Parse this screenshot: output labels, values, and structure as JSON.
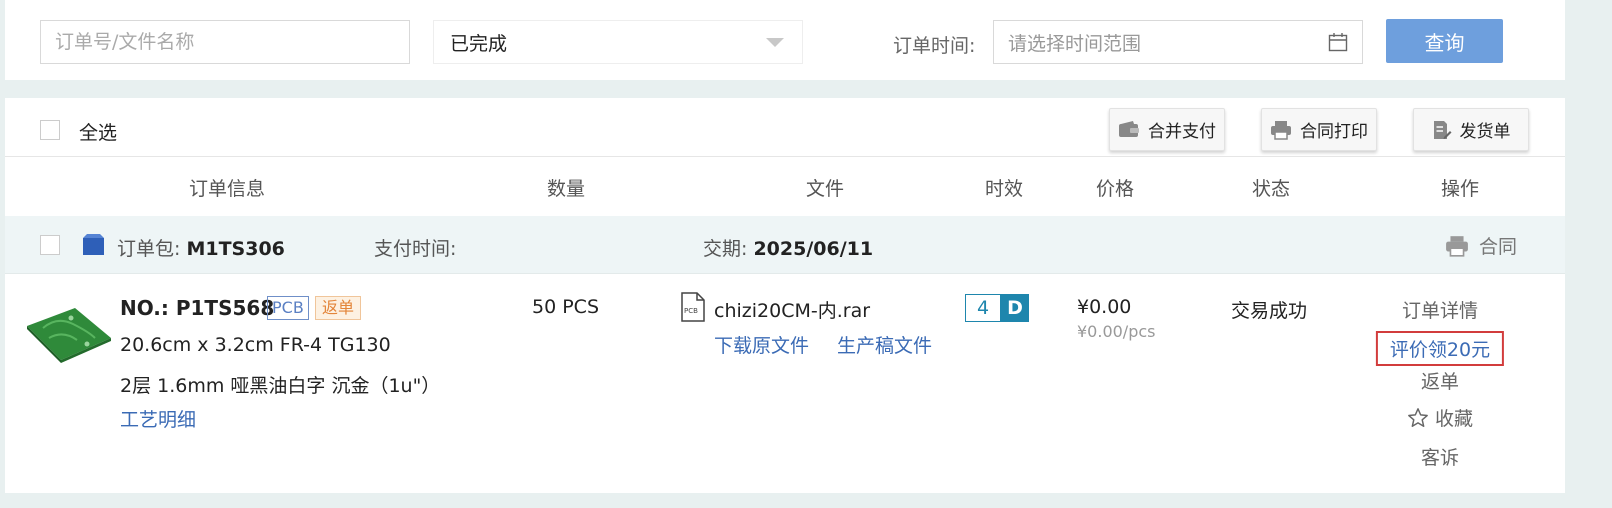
{
  "filters": {
    "search_placeholder": "订单号/文件名称",
    "status_value": "已完成",
    "time_label": "订单时间:",
    "time_placeholder": "请选择时间范围",
    "query_label": "查询"
  },
  "toolbar": {
    "select_all": "全选",
    "merge_pay": "合并支付",
    "merge_print": "合同打印",
    "shipping": "发货单"
  },
  "columns": [
    "订单信息",
    "数量",
    "文件",
    "时效",
    "价格",
    "状态",
    "操作"
  ],
  "package": {
    "label": "订单包:",
    "id": "M1TS306",
    "pay_time_label": "支付时间:",
    "delivery_label": "交期:",
    "delivery_date": "2025/06/11",
    "contract": "合同"
  },
  "order": {
    "number": "NO.: P1TS568",
    "type_tag": "PCB",
    "return_tag": "返单",
    "spec1": "20.6cm x 3.2cm FR-4 TG130",
    "spec2": "2层 1.6mm 哑黑油白字 沉金（1u\"）",
    "craft_link": "工艺明细",
    "quantity": "50 PCS",
    "file_icon_label": "PCB",
    "file_name": "chizi20CM-内.rar",
    "download_link": "下载原文件",
    "production_link": "生产稿文件",
    "lead_time": "4",
    "lead_unit": "D",
    "price": "¥0.00",
    "unit_price": "¥0.00/pcs",
    "status": "交易成功",
    "ops": {
      "detail": "订单详情",
      "review": "评价领20元",
      "reorder": "返单",
      "favorite": "收藏",
      "complain": "客诉"
    }
  },
  "colors": {
    "accent": "#3b6bb5",
    "query_button": "#6e9fdd",
    "lead_time": "#1e86ad",
    "highlight_border": "#d23c3c"
  }
}
